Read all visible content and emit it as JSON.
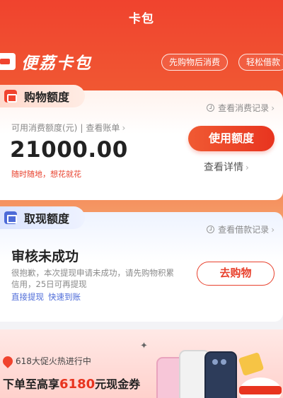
{
  "nav": {
    "title": "卡包"
  },
  "brand": {
    "name": "便荔卡包"
  },
  "pills": [
    "先购物后消费",
    "轻松借款"
  ],
  "shopping": {
    "tab_label": "购物额度",
    "record_link": "查看消费记录",
    "credit_label": "可用消费额度(元)",
    "bill_link": "查看账单",
    "amount": "21000.00",
    "slogan": "随时随地，想花就花",
    "use_button": "使用额度",
    "detail_link": "查看详情"
  },
  "cash": {
    "tab_label": "取现额度",
    "record_link": "查看借款记录",
    "status_title": "审核未成功",
    "status_desc": "很抱歉，本次提现申请未成功，请先购物积累信用，25日可再提现",
    "quick_link_1": "直接提现",
    "quick_link_2": "快速到账",
    "shop_button": "去购物"
  },
  "promo": {
    "tag": "618大促火热进行中",
    "main_prefix": "下单至高享",
    "main_amount": "6180",
    "main_suffix": "元现金券"
  },
  "colors": {
    "primary_red": "#e8341f",
    "hero_top": "#f0432e",
    "link_blue": "#4d6bd8"
  },
  "icons": [
    "card-wallet-icon",
    "shopping-bag-icon",
    "clock-icon",
    "cash-icon",
    "fire-icon",
    "phone-promo-image"
  ]
}
